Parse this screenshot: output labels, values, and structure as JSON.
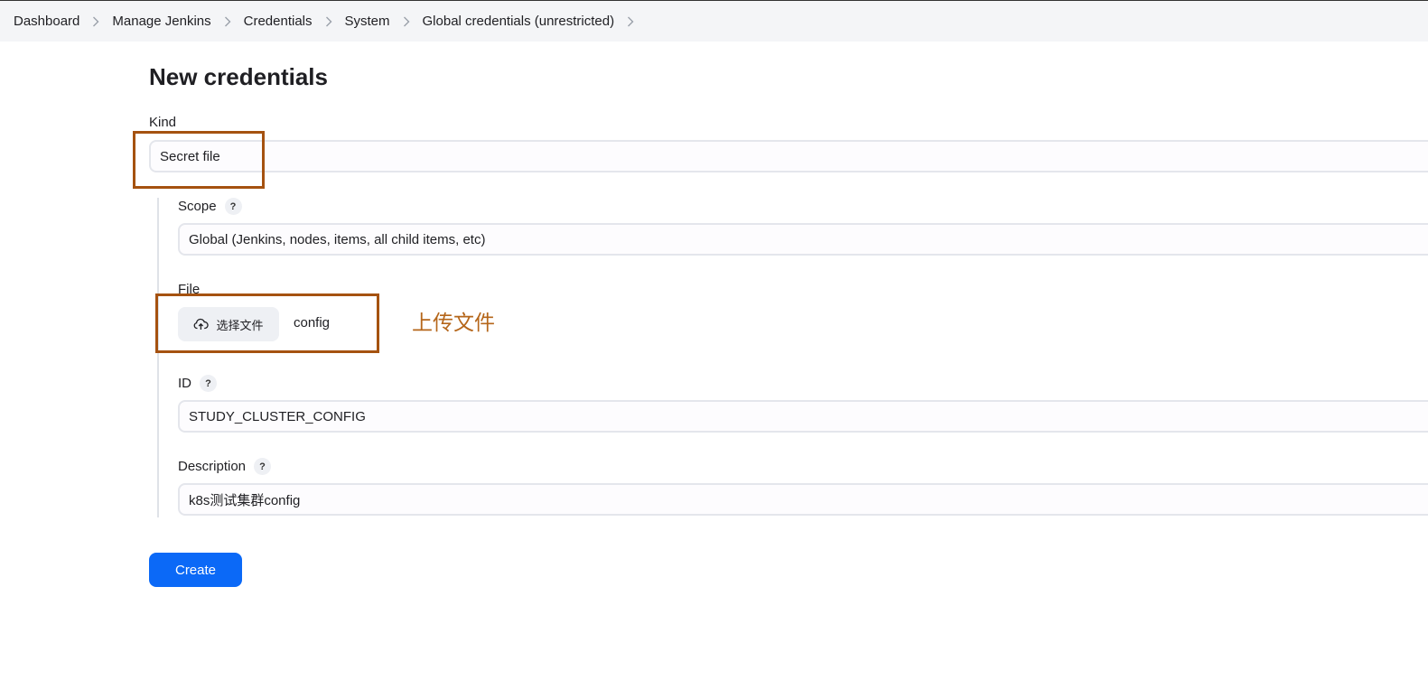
{
  "breadcrumb": {
    "items": [
      "Dashboard",
      "Manage Jenkins",
      "Credentials",
      "System",
      "Global credentials (unrestricted)"
    ]
  },
  "page": {
    "title": "New credentials"
  },
  "form": {
    "kind": {
      "label": "Kind",
      "value": "Secret file"
    },
    "scope": {
      "label": "Scope",
      "value": "Global (Jenkins, nodes, items, all child items, etc)",
      "help": "?"
    },
    "file": {
      "label": "File",
      "button_label": "选择文件",
      "file_name": "config"
    },
    "id": {
      "label": "ID",
      "value": "STUDY_CLUSTER_CONFIG",
      "help": "?"
    },
    "description": {
      "label": "Description",
      "value": "k8s测试集群config",
      "help": "?"
    },
    "create_label": "Create"
  },
  "annotation": {
    "text": "上传文件",
    "color": "#b5661a",
    "box_color": "#a55210"
  },
  "colors": {
    "primary": "#0b69f7",
    "breadcrumb_bg": "#f4f5f7"
  },
  "icons": {
    "separator": "chevron-right-icon",
    "upload": "cloud-upload-icon"
  }
}
